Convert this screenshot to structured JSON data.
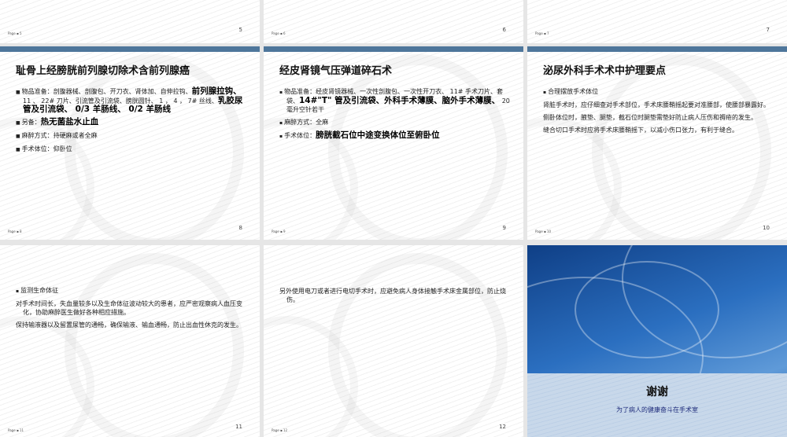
{
  "slides_top": [
    {
      "footer": "Page ▪ 5",
      "number": "5"
    },
    {
      "footer": "Page ▪ 6",
      "number": "6"
    },
    {
      "footer": "Page ▪ 7",
      "number": "7"
    }
  ],
  "slide8": {
    "footer": "Page ▪ 8",
    "number": "8",
    "title": "耻骨上经膀胱前列腺切除术含前列腺癌",
    "b1a": "物品准备：剖腹器械、剖腹包、开刀衣、肾体加、自伸拉钩、",
    "b1b": "前列腺拉钩、",
    "b1c": " 11 、 22# 刀片、引流管及引流袋、膀胱圆针、 1 ， 4 ， 7# 丝线、",
    "b1d": "乳胶尿管及引流袋、 0/3 羊肠线、 0/2 羊肠线",
    "b2a": "另备：",
    "b2b": "热无菌盐水止血",
    "b3": "麻醉方式：持硬麻或者全麻",
    "b4": "手术体位：仰卧位"
  },
  "slide9": {
    "footer": "Page ▪ 9",
    "number": "9",
    "title": "经皮肾镜气压弹道碎石术",
    "b1a": "物品准备：经皮肾镜器械、一次性剖腹包、一次性开刀衣、 11# 手术刀片、套袋、",
    "b1b": "14#\"T\" 管及引流袋、外科手术薄膜、脑外手术薄膜、",
    "b1c": " 20 毫升空针若干",
    "b2": "麻醉方式：全麻",
    "b3a": "手术体位：",
    "b3b": "膀胱截石位中途变换体位至俯卧位"
  },
  "slide10": {
    "footer": "Page ▪ 10",
    "number": "10",
    "title": "泌尿外科手术术中护理要点",
    "b1": "合理摆放手术体位",
    "p1": "肾脏手术时，应仔细查对手术部位，手术床腰鞘摇起要对准腰部，使腰部暴露好。",
    "p2": "侧卧体位时，腋垫、腿垫，截石位时腿垫需垫好防止病人压伤和褥疮的发生。",
    "p3": "缝合切口手术时应将手术床腰鞘摇下，以减小伤口张力，有利于缝合。"
  },
  "slide11": {
    "footer": "Page ▪ 11",
    "number": "11",
    "b1": "监测生命体征",
    "p1": "对手术时间长，失血量较多以及生命体征波动较大的患者，应严密观察病人血压变化，协助麻醉医生做好各种相应措施。",
    "p2": "保持输液器以及留置尿管的通畅，确保输液、输血通畅，防止出血性休克的发生。"
  },
  "slide12": {
    "footer": "Page ▪ 12",
    "number": "12",
    "p1": "另外使用电刀或者进行电切手术时，应避免病人身体接触手术床金属部位，防止烧伤。"
  },
  "slide13": {
    "title": "谢谢",
    "subtitle": "为了病人的健康奋斗在手术室"
  },
  "colors": {
    "accent_bar": "#4e769b",
    "end_bg": "#2b6fc0"
  }
}
